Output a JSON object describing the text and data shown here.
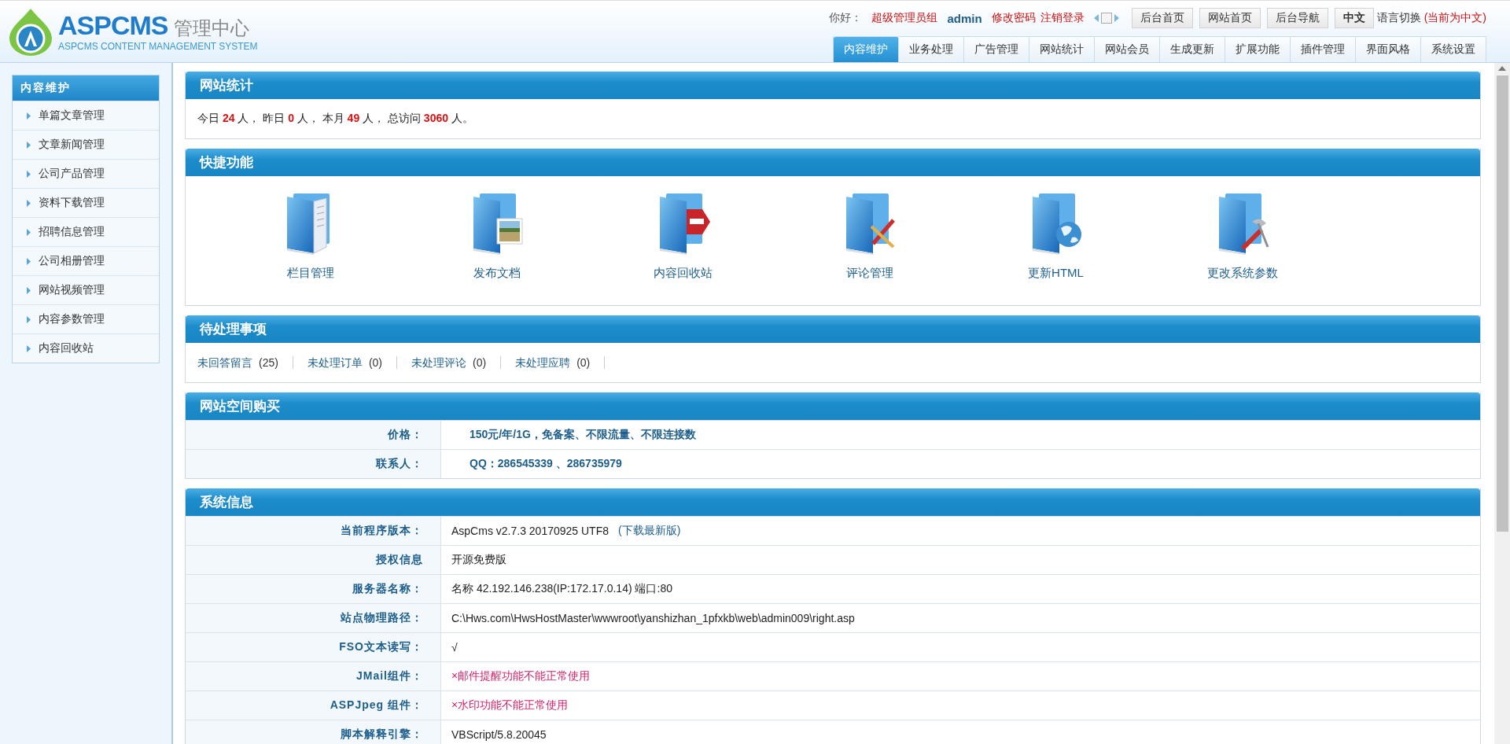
{
  "header": {
    "logo_title": "ASPCMS",
    "logo_suffix": "管理中心",
    "logo_subtitle": "ASPCMS CONTENT MANAGEMENT SYSTEM",
    "greeting": "你好：",
    "role": "超级管理员组",
    "user": "admin",
    "user_links": [
      "修改密码",
      "注销登录"
    ],
    "buttons": [
      {
        "label": "后台首页",
        "selected": false
      },
      {
        "label": "网站首页",
        "selected": false
      },
      {
        "label": "后台导航",
        "selected": false
      },
      {
        "label": "中文",
        "selected": true
      }
    ],
    "language_label": "语言切换",
    "language_current": "(当前为中文)"
  },
  "tabs": [
    {
      "label": "内容维护",
      "selected": true
    },
    {
      "label": "业务处理",
      "selected": false
    },
    {
      "label": "广告管理",
      "selected": false
    },
    {
      "label": "网站统计",
      "selected": false
    },
    {
      "label": "网站会员",
      "selected": false
    },
    {
      "label": "生成更新",
      "selected": false
    },
    {
      "label": "扩展功能",
      "selected": false
    },
    {
      "label": "插件管理",
      "selected": false
    },
    {
      "label": "界面风格",
      "selected": false
    },
    {
      "label": "系统设置",
      "selected": false
    }
  ],
  "sidebar": {
    "title": "内容维护",
    "items": [
      "单篇文章管理",
      "文章新闻管理",
      "公司产品管理",
      "资料下载管理",
      "招聘信息管理",
      "公司相册管理",
      "网站视频管理",
      "内容参数管理",
      "内容回收站"
    ]
  },
  "stats": {
    "title": "网站统计",
    "text": "今日 **24** 人， 昨日 **0** 人， 本月 **49** 人， 总访问 **3060** 人。"
  },
  "quick": {
    "title": "快捷功能",
    "items": [
      "栏目管理",
      "发布文档",
      "内容回收站",
      "评论管理",
      "更新HTML",
      "更改系统参数"
    ]
  },
  "pending": {
    "title": "待处理事项",
    "items": [
      {
        "label": "未回答留言",
        "count": "(25)"
      },
      {
        "label": "未处理订单",
        "count": "(0)"
      },
      {
        "label": "未处理评论",
        "count": "(0)"
      },
      {
        "label": "未处理应聘",
        "count": "(0)"
      }
    ]
  },
  "purchase": {
    "title": "网站空间购买",
    "rows": [
      {
        "label": "价格：",
        "value": "150元/年/1G，免备案、不限流量、不限连接数"
      },
      {
        "label": "联系人：",
        "value": "QQ：286545339 、286735979"
      }
    ]
  },
  "system": {
    "title": "系统信息",
    "rows": [
      {
        "label": "当前程序版本：",
        "value": "AspCms v2.7.3 20170925 UTF8",
        "link": "(下载最新版)",
        "kind": "normal"
      },
      {
        "label": "授权信息",
        "value": "开源免费版",
        "kind": "normal"
      },
      {
        "label": "服务器名称：",
        "value": "名称 42.192.146.238(IP:172.17.0.14) 端口:80",
        "kind": "normal"
      },
      {
        "label": "站点物理路径：",
        "value": "C:\\Hws.com\\HwsHostMaster\\wwwroot\\yanshizhan_1pfxkb\\web\\admin009\\right.asp",
        "kind": "normal"
      },
      {
        "label": "FSO文本读写：",
        "value": "√",
        "kind": "normal"
      },
      {
        "label": "JMail组件：",
        "value": "×邮件提醒功能不能正常使用",
        "kind": "error"
      },
      {
        "label": "ASPJpeg 组件：",
        "value": "×水印功能不能正常使用",
        "kind": "error"
      },
      {
        "label": "脚本解释引擎：",
        "value": "VBScript/5.8.20045",
        "kind": "normal"
      }
    ]
  }
}
